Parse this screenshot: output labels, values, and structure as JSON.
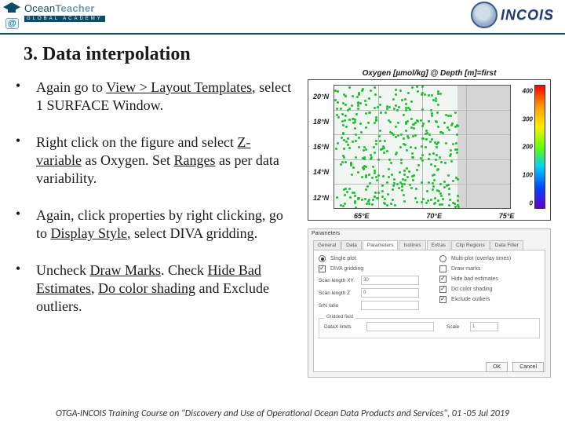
{
  "header": {
    "brand_word1": "Ocean",
    "brand_word2": "Teacher",
    "brand_sub": "GLOBAL ACADEMY",
    "at": "@",
    "right_label": "INCOIS"
  },
  "title": "3. Data interpolation",
  "bullets": [
    {
      "pre": "Again go to ",
      "u1": "View > Layout Templates",
      "mid": ", select 1 SURFACE Window.",
      "u2": "",
      "mid2": "",
      "u3": "",
      "post": ""
    },
    {
      "pre": "Right click on the figure and select ",
      "u1": "Z-variable",
      "mid": " as Oxygen. Set ",
      "u2": "Ranges",
      "mid2": " as per data variability.",
      "u3": "",
      "post": ""
    },
    {
      "pre": "Again, click properties by right clicking, go to ",
      "u1": "Display Style",
      "mid": ", select DIVA gridding.",
      "u2": "",
      "mid2": "",
      "u3": "",
      "post": ""
    },
    {
      "pre": "Uncheck ",
      "u1": "Draw Marks",
      "mid": ". Check ",
      "u2": "Hide Bad Estimates",
      "mid2": ", ",
      "u3": "Do color shading",
      "post": " and Exclude outliers."
    }
  ],
  "chart_data": {
    "type": "scatter",
    "title": "Oxygen [µmol/kg] @ Depth [m]=first",
    "x_ticks": [
      "65°E",
      "70°E",
      "75°E"
    ],
    "y_ticks": [
      "12°N",
      "14°N",
      "16°N",
      "18°N",
      "20°N"
    ],
    "xlim": [
      63,
      76
    ],
    "ylim": [
      11,
      21
    ],
    "colorbar": {
      "min": 0,
      "max": 400,
      "ticks": [
        0,
        100,
        200,
        300,
        400
      ]
    },
    "note": "Dense green scatter of station locations over the Arabian Sea region; grey land mass on right (Indian coast)."
  },
  "dialog": {
    "title": "Parameters",
    "tabs": [
      "General",
      "Data",
      "Parameters",
      "Isolines",
      "Extras",
      "Clip Regions",
      "Data Filter"
    ],
    "active_tab": 2,
    "radio_single": "Single plot",
    "radio_multi": "Multi-plot (overlay times)",
    "chk_diva": "DIVA gridding",
    "lbl_angle": "Scan length XY",
    "val_angle": "30",
    "lbl_overlap": "Scan length Z",
    "val_overlap": "0",
    "lbl_quality": "S/N ratio",
    "val_quality": "",
    "chk_marks": "Draw marks",
    "chk_hide": "Hide bad estimates",
    "chk_color": "Do color shading",
    "chk_exclude": "Exclude outliers",
    "group1": "Gridded field",
    "lbl_datax": "DataX limits",
    "val_datax": "",
    "lbl_scale": "Scale",
    "val_scale": "1",
    "btn_ok": "OK",
    "btn_cancel": "Cancel"
  },
  "footer": "OTGA-INCOIS Training Course on \"Discovery and Use of Operational Ocean Data Products and Services\", 01 -05 Jul 2019"
}
